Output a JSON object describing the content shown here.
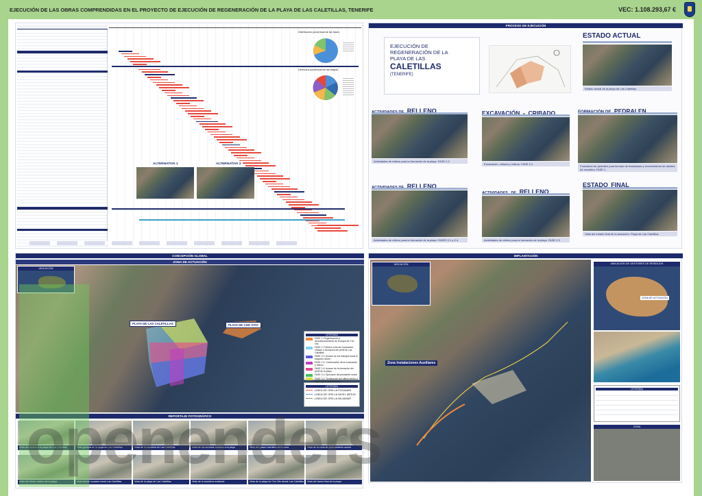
{
  "header": {
    "title": "EJECUCIÓN DE LAS OBRAS COMPRENDIDAS EN EL PROYECTO DE EJECUCIÓN DE REGENERACIÓN DE LA PLAYA DE LAS CALETILLAS, TENERIFE",
    "vec": "VEC: 1.108.293,67 €"
  },
  "proceso": {
    "header": "PROCESO DE EJECUCIÓN",
    "project_title_1": "EJECUCIÓN DE",
    "project_title_2": "REGENERACIÓN DE LA",
    "project_title_3": "PLAYA DE LAS",
    "project_title_4": "CALETILLAS",
    "project_title_5": "(TENERIFE)",
    "estado_actual": "ESTADO ACTUAL",
    "estado_actual_cap": "Estado actual de la playa de Las Caletillas",
    "relleno1_pre": "ACTIVIDADES DE",
    "relleno1": "RELLENO",
    "relleno1_cap": "Actividades de relleno para la formación de la playa. FASE 2.2",
    "excavacion_a": "EXCAVACIÓN",
    "excavacion_y": "y",
    "excavacion_b": "CRIBADO",
    "excavacion_cap": "Excavación, cribado y relleno. FASE 2.1",
    "pedralen_pre": "FORMACIÓN DE",
    "pedralen": "PEDRALEN",
    "pedralen_cap": "Formación de pedralen para llenado de trasdosado y recrecimiento de taludes de escollera. FASE 1",
    "relleno2_pre": "ACTIVIDADES DE",
    "relleno2": "RELLENO",
    "relleno2_cap": "Actividades de relleno para la formación de la playa. FASES 2.1 y 2.4",
    "relleno3_pre": "ACTIVIDADES",
    "relleno3_de": "DE",
    "relleno3": "RELLENO",
    "relleno3_cap": "Actividades de relleno para la formación de la playa. FASE 2.3",
    "estado_final_pre": "ESTADO",
    "estado_final": "FINAL",
    "estado_final_cap": "Vista del estado final de la actuación. Playa de Las Caletillas"
  },
  "gantt": {
    "pie1_title": "Distribución porcentual de las fases",
    "pie2_title": "Dirección porcentual de las etapas",
    "alt1": "ALTERNATIVA 1",
    "alt2": "ALTERNATIVA 2"
  },
  "concepcion": {
    "header": "CONCEPCIÓN GLOBAL",
    "zona": "ZONA DE ACTUACIÓN",
    "ubicacion": "UBICACIÓN",
    "playa_caletillas": "PLAYA DE LAS CALETILLAS",
    "playa_chovito": "PLAYA DE CHO VITO",
    "legend_title": "LEYENDA",
    "legend": [
      {
        "label": "FASE 1: Regeneración y acondicionamiento de la playa de Cho Vito",
        "color": "#f08a3a"
      },
      {
        "label": "FASE 2: Primera zona de excavación, cribado y formación del perfil de Las Caletillas",
        "color": "#7fd0f0"
      },
      {
        "label": "FASE 2.2: Avance de los trabajos hacia el segundo sector",
        "color": "#5a5ae0"
      },
      {
        "label": "FASE 2.3: Continuación de la excavación y relleno",
        "color": "#c040c0"
      },
      {
        "label": "FASE 2.4: Avance de la formación del perfil de la playa",
        "color": "#e84a8a"
      },
      {
        "label": "FASE 3.1: Ejecución del pendiente sector",
        "color": "#40c060"
      },
      {
        "label": "FASE 3.2: Terminación del último sector y cierre de la regeneración",
        "color": "#d8e04a"
      }
    ],
    "legend2_title": "LEYENDA",
    "legend2": [
      "LINEA DE ORILLA PLEAMAR",
      "LINEA DE ORILLA NIVEL MEDIO",
      "LINEA DE ORILLA BAJAMAR"
    ]
  },
  "implantacion": {
    "header": "IMPLANTACIÓN",
    "ubicacion": "UBICACIÓN",
    "gestores": "UBICACIÓN DE GESTORES DE RESIDUOS",
    "zona_actuacion": "ZONA DE ACTUACIÓN",
    "instalaciones": "Zona Instalaciones Auxiliares",
    "leyenda": "LEYENDA",
    "zona_label": "ZONA"
  },
  "reportaje": {
    "header": "REPORTAJE FOTOGRÁFICO",
    "captions": [
      "Vista del acceso a la playa de Las Caletillas",
      "Vista general de la playa de Las Caletillas",
      "Vista de la escollera de Las Caletillas",
      "Vista de los accesos rodados a la playa",
      "Vista del paseo marítimo de la zona",
      "Vista de la zona de aparcamiento actual",
      "Vista del frente costero de la playa",
      "Vista desde el paseo hacia Las Caletillas",
      "Vista de la playa de Las Caletillas",
      "Vista de la escollera existente",
      "Vista de la playa de Cho Vito desde Las Caletillas",
      "Vista del tramo final de la playa"
    ]
  },
  "watermark": "openenders"
}
